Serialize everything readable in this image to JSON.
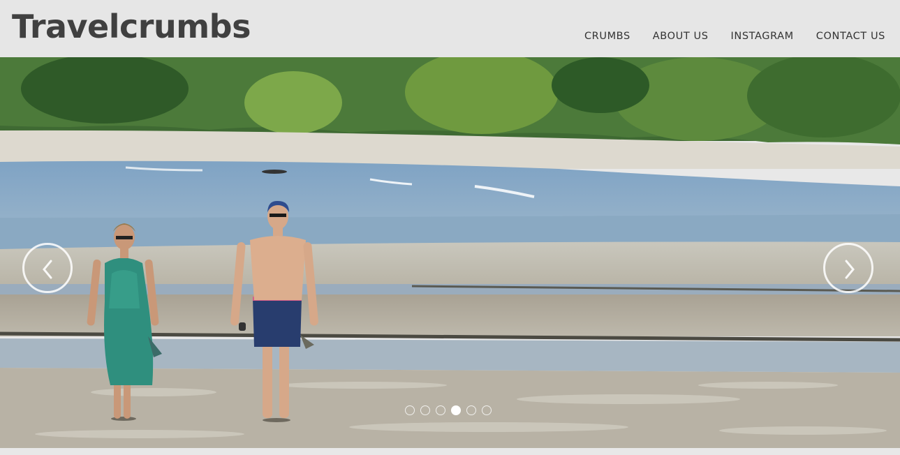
{
  "site": {
    "title": "Travelcrumbs"
  },
  "nav": {
    "items": [
      {
        "label": "CRUMBS"
      },
      {
        "label": "ABOUT US"
      },
      {
        "label": "INSTAGRAM"
      },
      {
        "label": "CONTACT US"
      }
    ]
  },
  "carousel": {
    "slide_count": 6,
    "active_index": 3,
    "prev_icon": "chevron-left-icon",
    "next_icon": "chevron-right-icon"
  },
  "colors": {
    "header_bg": "#e6e6e6",
    "title": "#404040",
    "nav_text": "#333333"
  }
}
